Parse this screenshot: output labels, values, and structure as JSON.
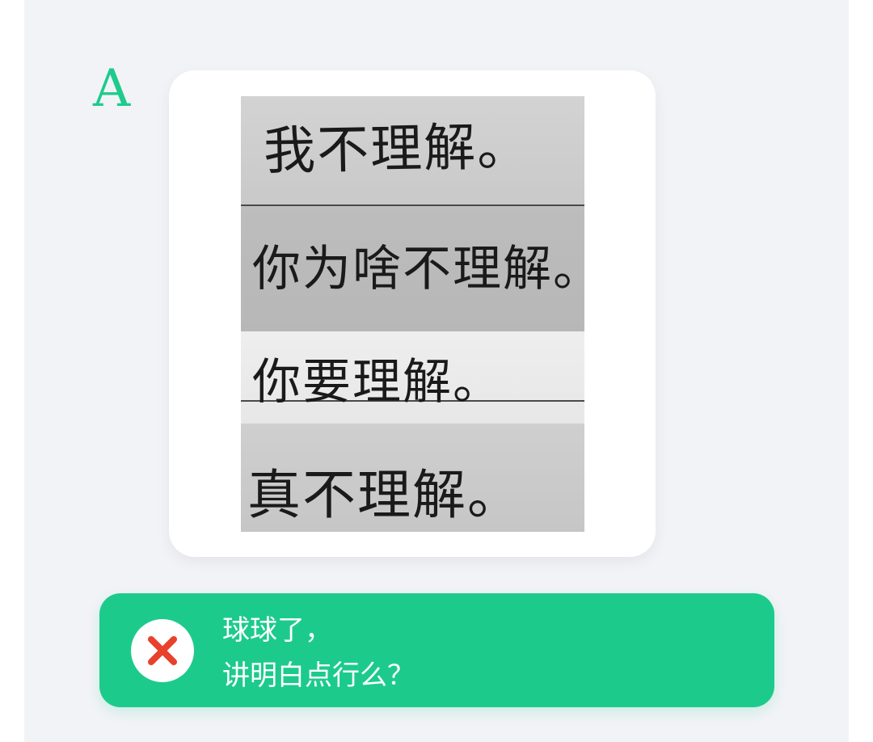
{
  "option": {
    "letter": "A"
  },
  "handwriting_image": {
    "lines": [
      "我不理解。",
      "你为啥不理解。",
      "你要理解。",
      "真不理解。"
    ]
  },
  "answer": {
    "status_icon": "wrong-x-icon",
    "line1": "球球了，",
    "line2": "讲明白点行么？",
    "accent_color": "#1ccb8c",
    "icon_color": "#e8412c"
  }
}
